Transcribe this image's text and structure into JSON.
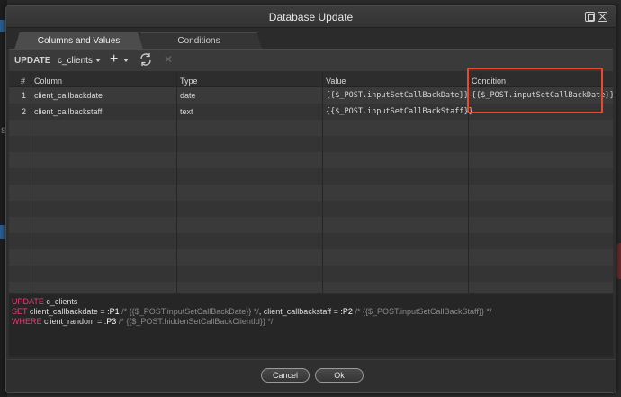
{
  "dialog": {
    "title": "Database Update"
  },
  "tabs": [
    {
      "label": "Columns and Values",
      "active": true
    },
    {
      "label": "Conditions",
      "active": false
    }
  ],
  "toolbar": {
    "update_label": "UPDATE",
    "table_name": "c_clients",
    "add_icon": "plus-icon",
    "refresh_icon": "refresh-icon",
    "delete_icon": "close-icon"
  },
  "grid": {
    "headers": [
      "#",
      "Column",
      "Type",
      "Value",
      "Condition"
    ],
    "rows": [
      {
        "num": "1",
        "column": "client_callbackdate",
        "type": "date",
        "value": "{{$_POST.inputSetCallBackDate}}",
        "condition": "{{$_POST.inputSetCallBackDate}}"
      },
      {
        "num": "2",
        "column": "client_callbackstaff",
        "type": "text",
        "value": "{{$_POST.inputSetCallBackStaff}}",
        "condition": ""
      }
    ]
  },
  "sql": {
    "line1": {
      "kw": "UPDATE",
      "text": " c_clients"
    },
    "line2": {
      "kw": "SET",
      "a": " client_callbackdate = ",
      "p1": ":P1",
      "c1": " /* {{$_POST.inputSetCallBackDate}} */",
      "b": ", client_callbackstaff = ",
      "p2": ":P2",
      "c2": " /* {{$_POST.inputSetCallBackStaff}} */"
    },
    "line3": {
      "kw": "WHERE",
      "a": " client_random = ",
      "p3": ":P3",
      "c3": " /* {{$_POST.hiddenSetCallBackClientId}} */"
    }
  },
  "footer": {
    "cancel_label": "Cancel",
    "ok_label": "Ok"
  },
  "colors": {
    "sql_keyword": "#e0407a",
    "highlight_box": "#e8492f"
  }
}
